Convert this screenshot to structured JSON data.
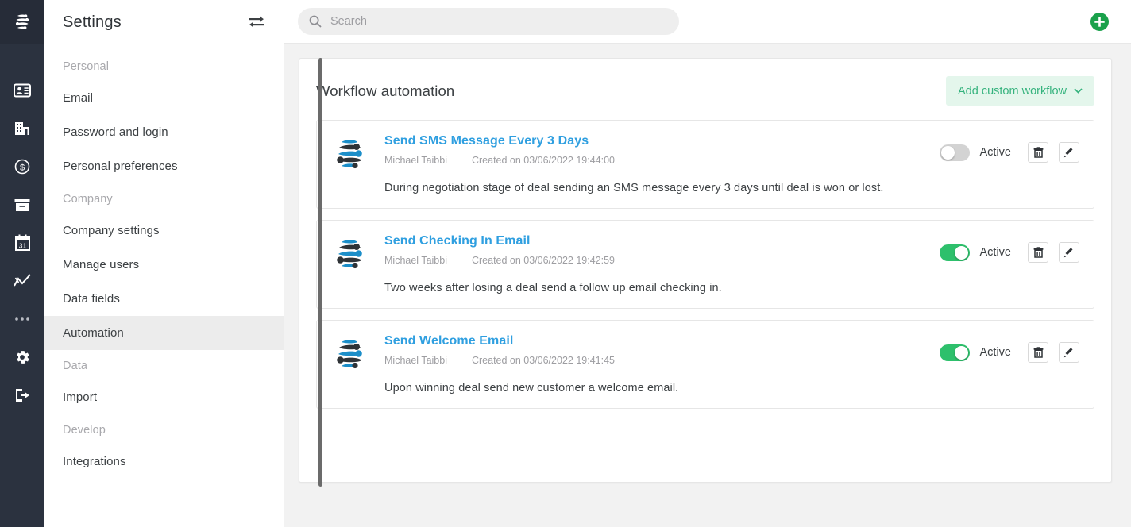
{
  "rail": {
    "logo_icon": "globe-logo-icon",
    "items": [
      {
        "name": "contacts-icon"
      },
      {
        "name": "companies-icon"
      },
      {
        "name": "deals-icon"
      },
      {
        "name": "archive-icon"
      },
      {
        "name": "calendar-icon"
      },
      {
        "name": "reports-icon"
      },
      {
        "name": "more-icon"
      },
      {
        "name": "settings-icon"
      },
      {
        "name": "logout-icon"
      }
    ]
  },
  "settings": {
    "title": "Settings",
    "swap_icon": "swap-arrows-icon",
    "groups": [
      {
        "label": "Personal",
        "items": [
          {
            "label": "Email",
            "active": false
          },
          {
            "label": "Password and login",
            "active": false
          },
          {
            "label": "Personal preferences",
            "active": false
          }
        ]
      },
      {
        "label": "Company",
        "items": [
          {
            "label": "Company settings",
            "active": false
          },
          {
            "label": "Manage users",
            "active": false
          },
          {
            "label": "Data fields",
            "active": false
          },
          {
            "label": "Automation",
            "active": true
          }
        ]
      },
      {
        "label": "Data",
        "items": [
          {
            "label": "Import",
            "active": false
          }
        ]
      },
      {
        "label": "Develop",
        "items": [
          {
            "label": "Integrations",
            "active": false
          }
        ]
      }
    ]
  },
  "topbar": {
    "search": {
      "value": "",
      "placeholder": "Search",
      "icon": "search-icon"
    },
    "add_button": {
      "name": "add-circle-button",
      "icon": "plus-circle-icon",
      "color": "#1aa14b"
    }
  },
  "panel": {
    "title": "Workflow automation",
    "add_workflow_label": "Add custom workflow",
    "add_workflow_chevron": "chevron-down-icon",
    "accent_color": "#36b37e",
    "workflows": [
      {
        "name": "Send SMS Message Every 3 Days",
        "author": "Michael Taibbi",
        "created": "Created on 03/06/2022 19:44:00",
        "description": "During negotiation stage of deal sending an SMS message every 3 days until deal is won or lost.",
        "toggle_on": false,
        "status_label": "Active",
        "delete_icon": "trash-icon",
        "edit_icon": "pencil-icon"
      },
      {
        "name": "Send Checking In Email",
        "author": "Michael Taibbi",
        "created": "Created on 03/06/2022 19:42:59",
        "description": "Two weeks after losing a deal send a follow up email checking in.",
        "toggle_on": true,
        "status_label": "Active",
        "delete_icon": "trash-icon",
        "edit_icon": "pencil-icon"
      },
      {
        "name": "Send Welcome Email",
        "author": "Michael Taibbi",
        "created": "Created on 03/06/2022 19:41:45",
        "description": "Upon winning deal send new customer a welcome email.",
        "toggle_on": true,
        "status_label": "Active",
        "delete_icon": "trash-icon",
        "edit_icon": "pencil-icon"
      }
    ]
  }
}
